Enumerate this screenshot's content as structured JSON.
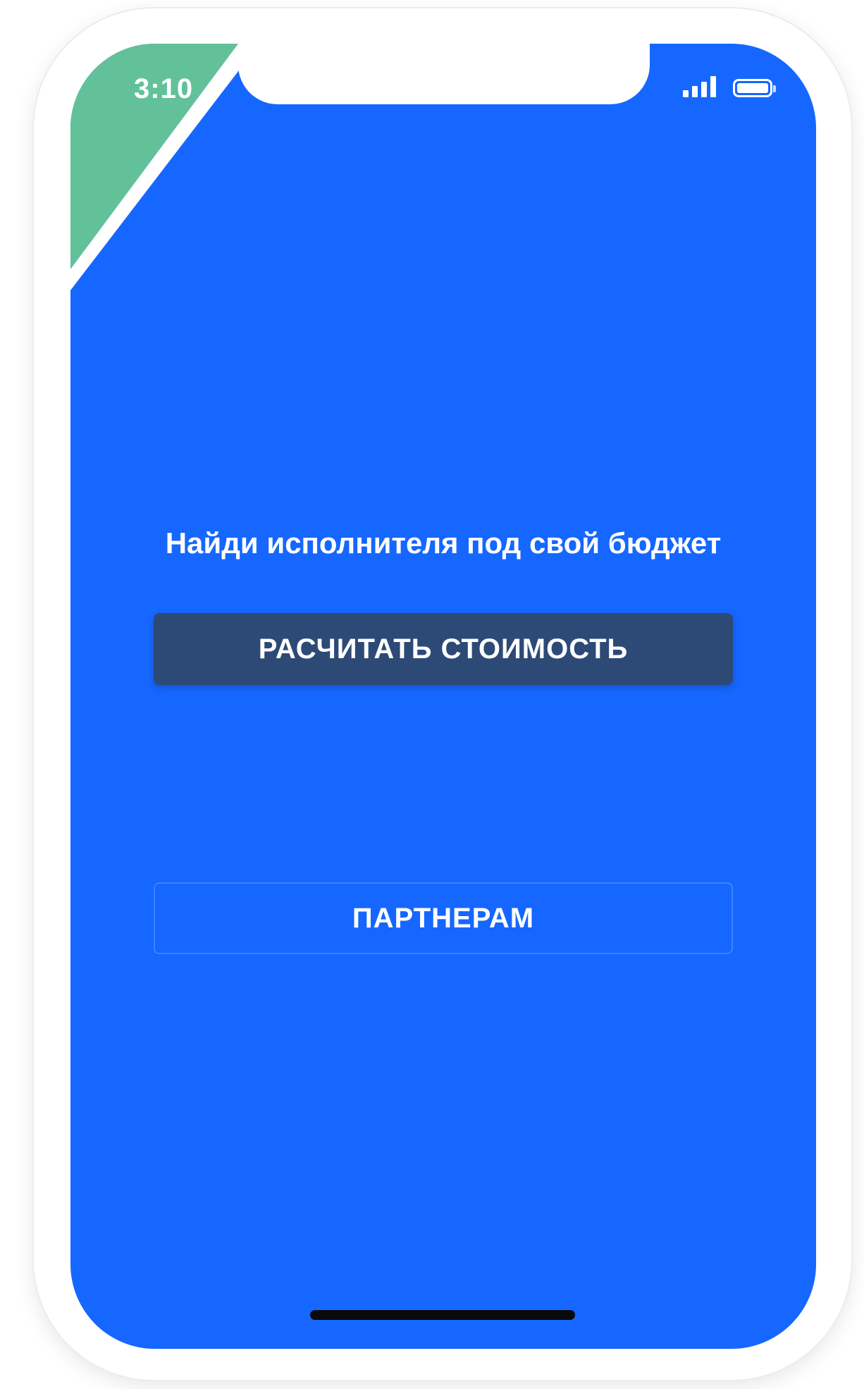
{
  "colors": {
    "screen_background": "#1567ff",
    "ribbon_green": "#63c19a",
    "primary_button": "#2d4a77",
    "text": "#ffffff"
  },
  "status_bar": {
    "time": "3:10",
    "icons": [
      "signal-icon",
      "battery-icon"
    ]
  },
  "main": {
    "headline": "Найди исполнителя под свой бюджет",
    "primary_button_label": "РАСЧИТАТЬ СТОИМОСТЬ",
    "secondary_button_label": "ПАРТНЕРАМ"
  }
}
